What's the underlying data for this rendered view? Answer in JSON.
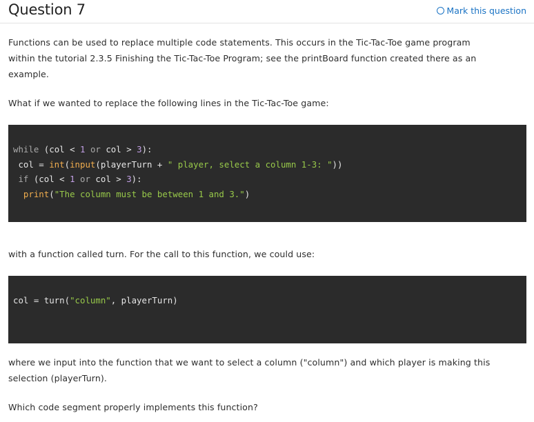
{
  "header": {
    "title": "Question 7",
    "mark_label": "Mark this question"
  },
  "paragraphs": {
    "intro_1": "Functions can be used to replace multiple code statements. This occurs in the Tic-Tac-Toe game program",
    "intro_2": "within the tutorial 2.3.5 Finishing the Tic-Tac-Toe Program; see the printBoard function created there as an",
    "intro_3": "example.",
    "what_if": "What if we wanted to replace the following lines in the Tic-Tac-Toe game:",
    "with_fn": "with a function called turn. For the call to this function, we could use:",
    "where_1": "where we input into the function that we want to select a column (\"column\") and which player is making this",
    "where_2": "selection (playerTurn).",
    "which": "Which code segment properly implements this function?"
  },
  "code_block_1": {
    "lines": [
      "while (col < 1 or col > 3):",
      " col = int(input(playerTurn + \" player, select a column 1-3: \"))",
      " if (col < 1 or col > 3):",
      "  print(\"The column must be between 1 and 3.\")"
    ]
  },
  "code_block_2": {
    "lines": [
      "col = turn(\"column\", playerTurn)"
    ]
  }
}
